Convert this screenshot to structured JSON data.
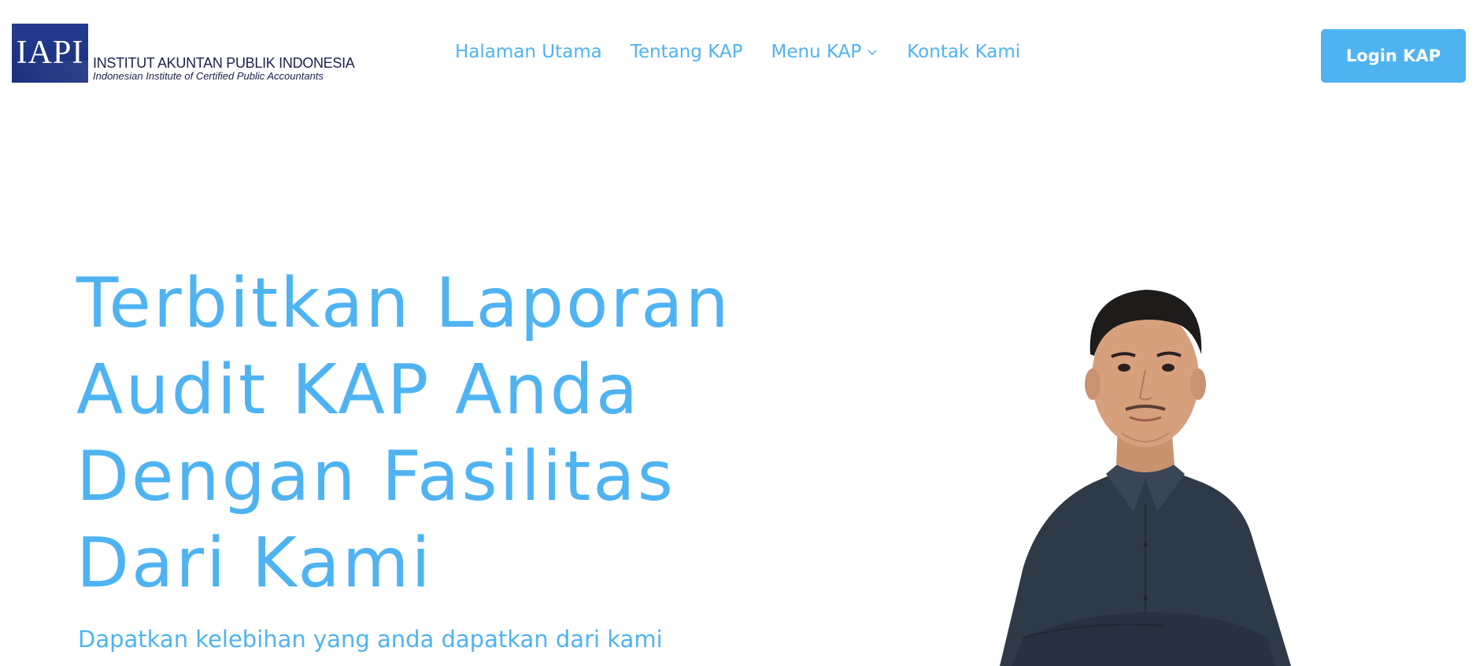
{
  "header": {
    "logo": {
      "mark": "IAPI",
      "name": "INSTITUT AKUNTAN PUBLIK INDONESIA",
      "tagline": "Indonesian Institute of Certified Public Accountants"
    },
    "nav": [
      {
        "label": "Halaman Utama"
      },
      {
        "label": "Tentang KAP"
      },
      {
        "label": "Menu KAP",
        "has_dropdown": true
      },
      {
        "label": "Kontak Kami"
      }
    ],
    "login_label": "Login KAP"
  },
  "hero": {
    "title_lines": [
      "Terbitkan Laporan",
      "Audit KAP Anda",
      "Dengan Fasilitas",
      "Dari Kami"
    ],
    "subtitle": "Dapatkan kelebihan yang anda dapatkan dari kami",
    "image_alt": "man-with-crossed-arms-photo"
  },
  "colors": {
    "accent": "#4fb3f2",
    "logo_navy": "#1c2f7d",
    "background": "#ffffff"
  },
  "icons": {
    "dropdown": "chevron-down-icon"
  }
}
